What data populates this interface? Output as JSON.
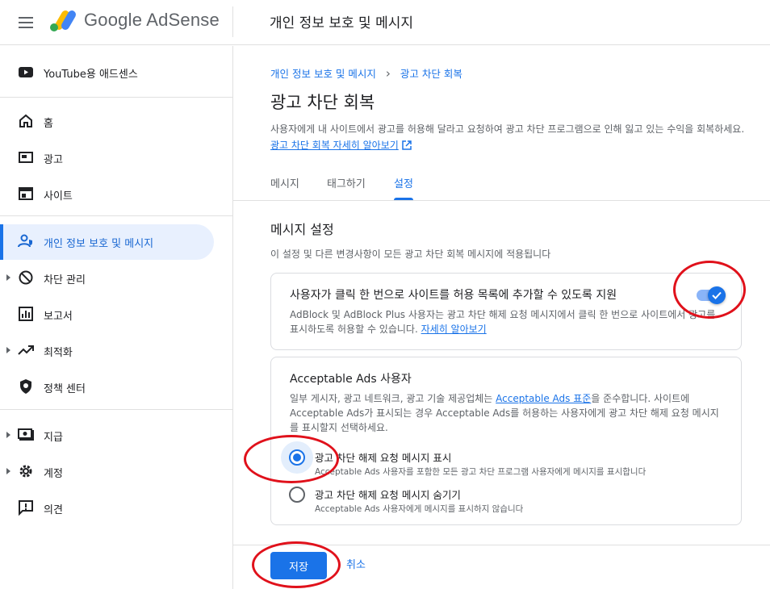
{
  "header": {
    "brand": "Google AdSense",
    "title": "개인 정보 보호 및 메시지"
  },
  "sidebar": {
    "youtube": "YouTube용 애드센스",
    "items": [
      {
        "label": "홈",
        "icon": "home-icon"
      },
      {
        "label": "광고",
        "icon": "ads-icon"
      },
      {
        "label": "사이트",
        "icon": "sites-icon"
      },
      {
        "label": "개인 정보 보호 및 메시지",
        "icon": "privacy-messaging-icon",
        "active": true
      },
      {
        "label": "차단 관리",
        "icon": "block-icon",
        "expandable": true
      },
      {
        "label": "보고서",
        "icon": "reports-icon"
      },
      {
        "label": "최적화",
        "icon": "optimization-icon",
        "expandable": true
      },
      {
        "label": "정책 센터",
        "icon": "policy-shield-icon"
      },
      {
        "label": "지급",
        "icon": "payments-icon",
        "expandable": true
      },
      {
        "label": "계정",
        "icon": "gear-icon",
        "expandable": true
      },
      {
        "label": "의견",
        "icon": "feedback-icon"
      }
    ]
  },
  "main": {
    "breadcrumb": {
      "parent": "개인 정보 보호 및 메시지",
      "current": "광고 차단 회복"
    },
    "title": "광고 차단 회복",
    "description": "사용자에게 내 사이트에서 광고를 허용해 달라고 요청하여 광고 차단 프로그램으로 인해 잃고 있는 수익을 회복하세요.",
    "learn_more": "광고 차단 회복 자세히 알아보기",
    "tabs": [
      "메시지",
      "태그하기",
      "설정"
    ],
    "active_tab": "설정",
    "section_title": "메시지 설정",
    "section_desc": "이 설정 및 다른 변경사항이 모든 광고 차단 회복 메시지에 적용됩니다",
    "allowlist_card": {
      "title": "사용자가 클릭 한 번으로 사이트를 허용 목록에 추가할 수 있도록 지원",
      "desc": "AdBlock 및 AdBlock Plus 사용자는 광고 차단 해제 요청 메시지에서 클릭 한 번으로 사이트에서 광고를 표시하도록 허용할 수 있습니다.",
      "learn_more": "자세히 알아보기",
      "enabled": true
    },
    "acceptable_ads_card": {
      "title": "Acceptable Ads 사용자",
      "desc_before": "일부 게시자, 광고 네트워크, 광고 기술 제공업체는",
      "desc_link": "Acceptable Ads 표준",
      "desc_after": "을 준수합니다. 사이트에 Acceptable Ads가 표시되는 경우 Acceptable Ads를 허용하는 사용자에게 광고 차단 해제 요청 메시지를 표시할지 선택하세요.",
      "options": [
        {
          "label": "광고 차단 해제 요청 메시지 표시",
          "sub": "Acceptable Ads 사용자를 포함한 모든 광고 차단 프로그램 사용자에게 메시지를 표시합니다",
          "checked": true
        },
        {
          "label": "광고 차단 해제 요청 메시지 숨기기",
          "sub": "Acceptable Ads 사용자에게 메시지를 표시하지 않습니다",
          "checked": false
        }
      ]
    },
    "save": "저장",
    "cancel": "취소"
  },
  "colors": {
    "accent": "#1a73e8",
    "annotation": "#e0111b"
  }
}
